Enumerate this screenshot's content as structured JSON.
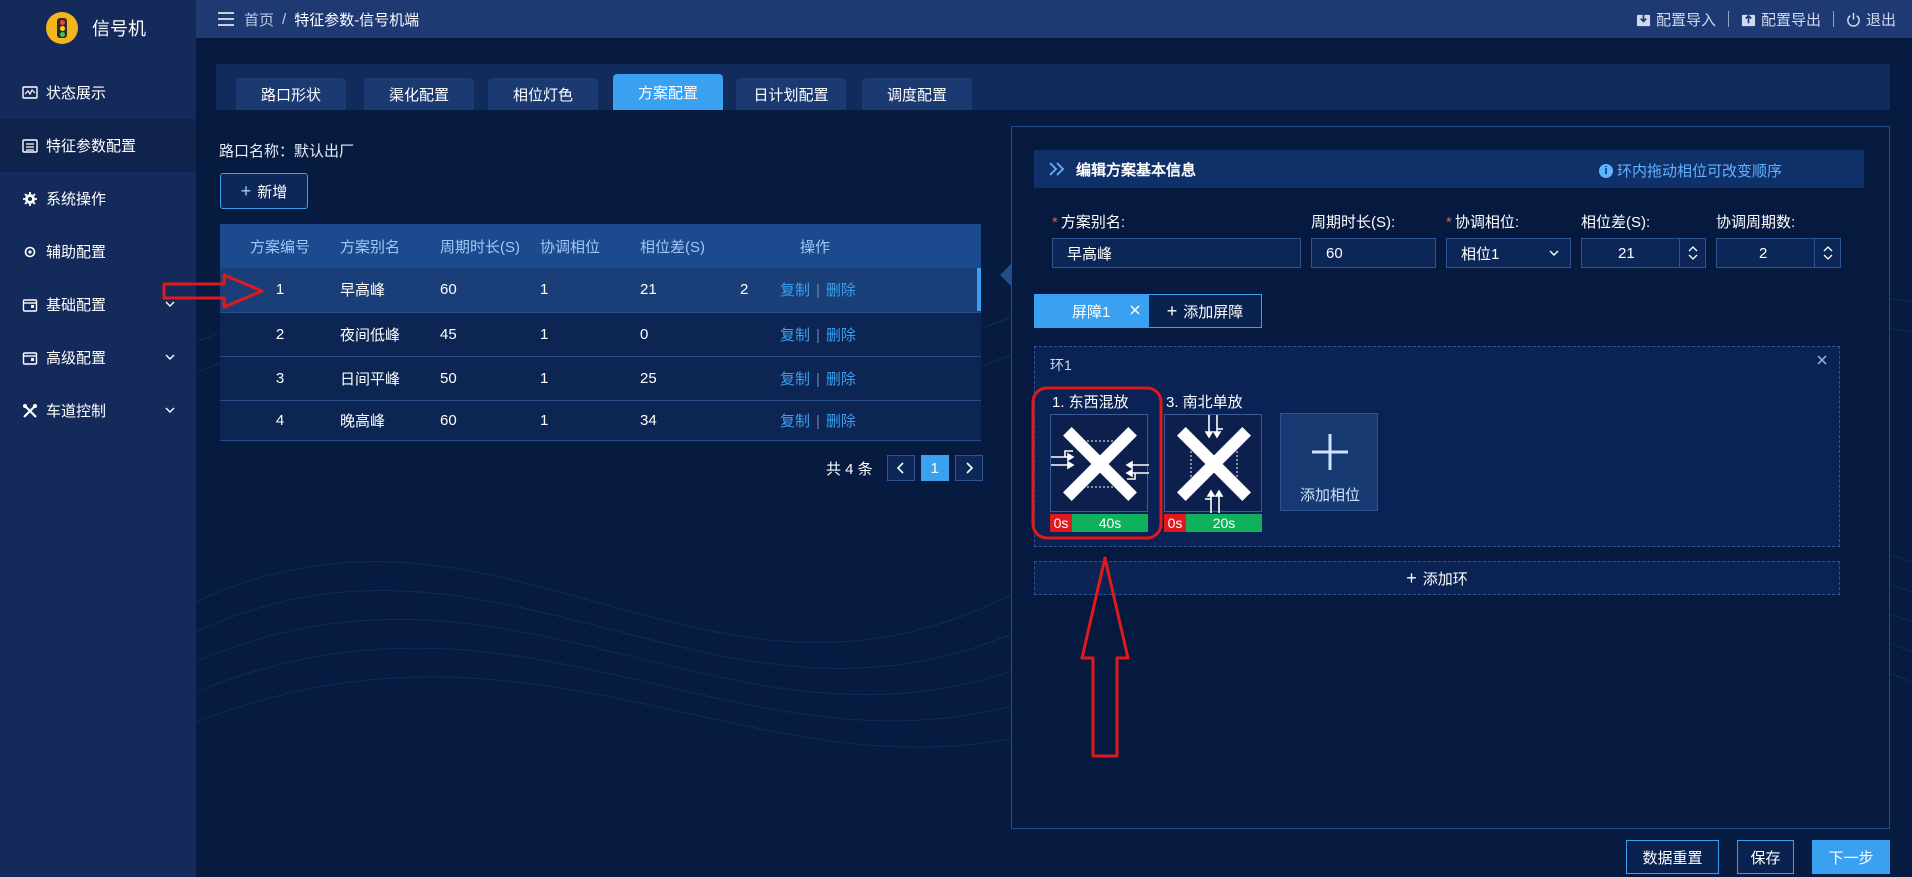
{
  "app": {
    "title": "信号机"
  },
  "sidebar": {
    "items": [
      {
        "label": "状态展示",
        "icon": "monitor-icon"
      },
      {
        "label": "特征参数配置",
        "icon": "list-icon",
        "active": true
      },
      {
        "label": "系统操作",
        "icon": "gear-icon"
      },
      {
        "label": "辅助配置",
        "icon": "cog-icon"
      },
      {
        "label": "基础配置",
        "icon": "calendar-icon",
        "expandable": true
      },
      {
        "label": "高级配置",
        "icon": "calendar-icon",
        "expandable": true
      },
      {
        "label": "车道控制",
        "icon": "tools-icon",
        "expandable": true
      }
    ]
  },
  "header": {
    "breadcrumb": {
      "home": "首页",
      "separator": "/",
      "current": "特征参数-信号机端"
    },
    "actions": {
      "import": "配置导入",
      "export": "配置导出",
      "logout": "退出"
    }
  },
  "tabs": [
    "路口形状",
    "渠化配置",
    "相位灯色",
    "方案配置",
    "日计划配置",
    "调度配置"
  ],
  "active_tab": "方案配置",
  "crossing": {
    "label": "路口名称：",
    "value": "默认出厂"
  },
  "add_button": "新增",
  "table": {
    "headers": [
      "方案编号",
      "方案别名",
      "周期时长(S)",
      "协调相位",
      "相位差(S)",
      "操作"
    ],
    "rows": [
      {
        "no": "1",
        "alias": "早高峰",
        "cycle": "60",
        "coord": "1",
        "offset": "21",
        "extra": "2",
        "copy": "复制",
        "delete": "删除"
      },
      {
        "no": "2",
        "alias": "夜间低峰",
        "cycle": "45",
        "coord": "1",
        "offset": "0",
        "extra": "",
        "copy": "复制",
        "delete": "删除"
      },
      {
        "no": "3",
        "alias": "日间平峰",
        "cycle": "50",
        "coord": "1",
        "offset": "25",
        "extra": "",
        "copy": "复制",
        "delete": "删除"
      },
      {
        "no": "4",
        "alias": "晚高峰",
        "cycle": "60",
        "coord": "1",
        "offset": "34",
        "extra": "",
        "copy": "复制",
        "delete": "删除"
      }
    ]
  },
  "pager": {
    "total": "共 4 条",
    "current": "1"
  },
  "edit": {
    "title": "编辑方案基本信息",
    "hint": "环内拖动相位可改变顺序",
    "fields": {
      "alias_label": "方案别名:",
      "alias_value": "早高峰",
      "cycle_label": "周期时长(S):",
      "cycle_value": "60",
      "coord_label": "协调相位:",
      "coord_value": "相位1",
      "offset_label": "相位差(S):",
      "offset_value": "21",
      "cycles_label": "协调周期数:",
      "cycles_value": "2"
    },
    "barrier_tab": "屏障1",
    "add_barrier": "添加屏障",
    "ring": {
      "label": "环1",
      "phases": [
        {
          "title": "1. 东西混放",
          "red": "0s",
          "green": "40s"
        },
        {
          "title": "3. 南北单放",
          "red": "0s",
          "green": "20s"
        }
      ],
      "add_phase": "添加相位"
    },
    "add_ring": "添加环"
  },
  "footer": {
    "reset": "数据重置",
    "save": "保存",
    "next": "下一步"
  },
  "colors": {
    "accent": "#3aa0f0",
    "sidebar": "#142a5a",
    "background": "#071a40",
    "red_timing": "#e0191c",
    "green_timing": "#0fb15a",
    "annotation": "#e0191c"
  }
}
